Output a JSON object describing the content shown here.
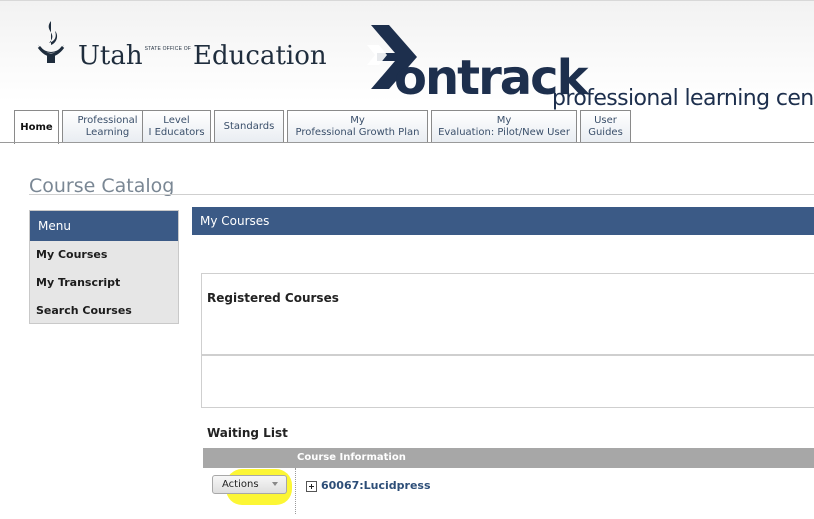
{
  "header": {
    "logo_utah_left": "Utah",
    "logo_seal_text": "STATE OFFICE OF",
    "logo_utah_right": "Education",
    "ontrack_word": "ontrack",
    "ontrack_tagline": "professional learning center"
  },
  "tabs": [
    {
      "line1": "Home",
      "line2": ""
    },
    {
      "line1": "Professional",
      "line2": "Learning"
    },
    {
      "line1": "Level",
      "line2": "I Educators"
    },
    {
      "line1": "Standards",
      "line2": ""
    },
    {
      "line1": "My",
      "line2": "Professional Growth Plan"
    },
    {
      "line1": "My",
      "line2": "Evaluation: Pilot/New User"
    },
    {
      "line1": "User",
      "line2": "Guides"
    }
  ],
  "page_title": "Course Catalog",
  "menu": {
    "heading": "Menu",
    "items": [
      "My Courses",
      "My Transcript",
      "Search Courses"
    ]
  },
  "main": {
    "heading": "My Courses",
    "registered_title": "Registered Courses",
    "waiting_title": "Waiting List",
    "table_header": "Course Information",
    "row": {
      "actions_label": "Actions",
      "course": "60067:Lucidpress"
    }
  },
  "colors": {
    "header_blue": "#3b5a86",
    "highlight": "#fcf52a",
    "link": "#2d4e78"
  }
}
